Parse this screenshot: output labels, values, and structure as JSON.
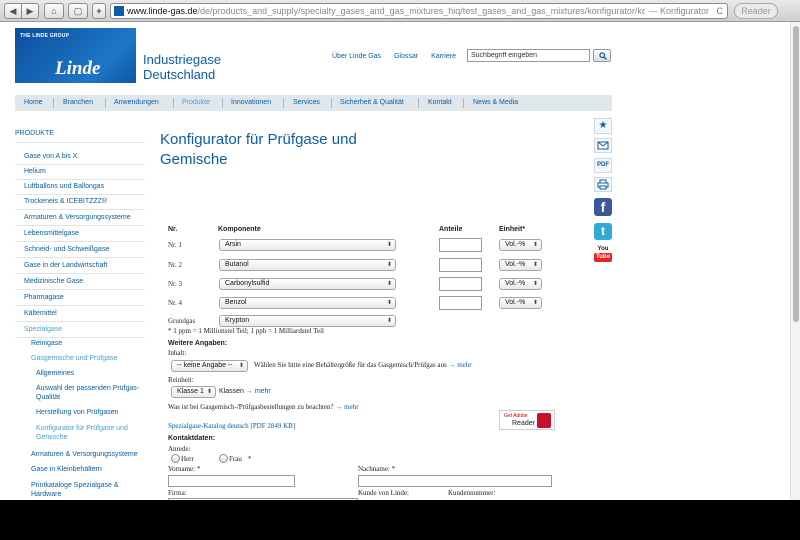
{
  "browser": {
    "url_host": "www.linde-gas.de",
    "url_path": "/de/products_and_supply/specialty_gases_and_gas_mixtures_hiq/test_gases_and_gas_mixtures/konfigurator/konfigurator.html",
    "url_suffix": "— Konfigurator",
    "reader_label": "Reader",
    "back_glyph": "◀",
    "forward_glyph": "▶",
    "home_glyph": "⌂",
    "rss_glyph": "▢",
    "add_glyph": "+",
    "reload_glyph": "C"
  },
  "header": {
    "logo_group": "THE LINDE GROUP",
    "logo_word": "Linde",
    "site_title_line1": "Industriegase",
    "site_title_line2": "Deutschland",
    "top_links": [
      "Über Linde Gas",
      "Glossar",
      "Karriere"
    ],
    "search_placeholder": "Suchbegriff eingeben"
  },
  "main_nav": {
    "items": [
      "Home",
      "Branchen",
      "Anwendungen",
      "Produkte",
      "Innovationen",
      "Services",
      "Sicherheit & Qualität",
      "Kontakt",
      "News & Media"
    ]
  },
  "sidebar": {
    "heading": "PRODUKTE",
    "items": [
      "Gase von A bis X",
      "Helium",
      "Luftballons und Ballongas",
      "Trockeneis & ICEBITZZZ®",
      "Armaturen & Versorgungssysteme",
      "Lebensmittelgase",
      "Schneid- und Schweißgase",
      "Gase in der Landwirtschaft",
      "Medizinische Gase",
      "Pharmagase",
      "Kältemittel",
      "Spezialgase",
      "Reinigase",
      "Gasgemische und Prüfgase",
      "Allgemeines",
      "Auswahl der passenden Prüfgas-",
      "Qualität",
      "Herstellung von Prüfgasen",
      "Konfigurator für Prüfgase und",
      "Gemische",
      "Armaturen & Versorgungssysteme",
      "Gase in Kleinbehältern",
      "Printkataloge Spezialgase &",
      "Hardware"
    ]
  },
  "content": {
    "title_line1": "Konfigurator für Prüfgase und",
    "title_line2": "Gemische",
    "col_nr": "Nr.",
    "col_komponente": "Komponente",
    "col_anteile": "Anteile",
    "col_einheit": "Einheit*",
    "rows": [
      {
        "label": "Nr. 1",
        "component": "Arsin",
        "unit": "Vol.-%"
      },
      {
        "label": "Nr. 2",
        "component": "Butanol",
        "unit": "Vol.-%"
      },
      {
        "label": "Nr. 3",
        "component": "Carbonylsulfid",
        "unit": "Vol.-%"
      },
      {
        "label": "Nr. 4",
        "component": "Benzol",
        "unit": "Vol.-%"
      }
    ],
    "grundgas_label": "Grundgas",
    "grundgas_value": "Krypton",
    "footnote": "* 1 ppm = 1 Millionstel Teil; 1 ppb = 1 Milliardstel Teil",
    "weitere_heading": "Weitere Angaben:",
    "inhalt_label": "Inhalt:",
    "inhalt_value": "-- keine Angabe --",
    "inhalt_help": "Wählen Sie bitte eine Behältergröße für das Gasgemisch/Prüfgas aus",
    "mehr": "mehr",
    "reinheit_label": "Reinheit:",
    "reinheit_value": "Klasse 1",
    "reinheit_suffix": "Klassen",
    "question": "Was ist bei Gasgemisch-/Prüfgasbestellungen zu beachten?",
    "catalog_link": "Spezialgase-Katalog deutsch [PDF 2849 KB]",
    "adobe_line1": "Get Adobe",
    "adobe_line2": "Reader",
    "kontakt_heading": "Kontaktdaten:",
    "anrede_label": "Anrede:",
    "herr": "Herr",
    "frau": "Frau",
    "frau_required": "*",
    "vorname_label": "Vorname: *",
    "nachname_label": "Nachname: *",
    "firma_label": "Firma:",
    "kunde_label": "Kunde von Linde:",
    "kundennummer_label": "Kundennummer:"
  },
  "social": {
    "bookmark_glyph": "★",
    "pdf_label": "PDF",
    "facebook_glyph": "f",
    "twitter_glyph": "t",
    "youtube_top": "You",
    "youtube_bottom": "Tube"
  },
  "colors": {
    "brand_blue": "#0a5ea8",
    "nav_bg": "#dfe6ec",
    "active_light_blue": "#4aa0d8"
  }
}
